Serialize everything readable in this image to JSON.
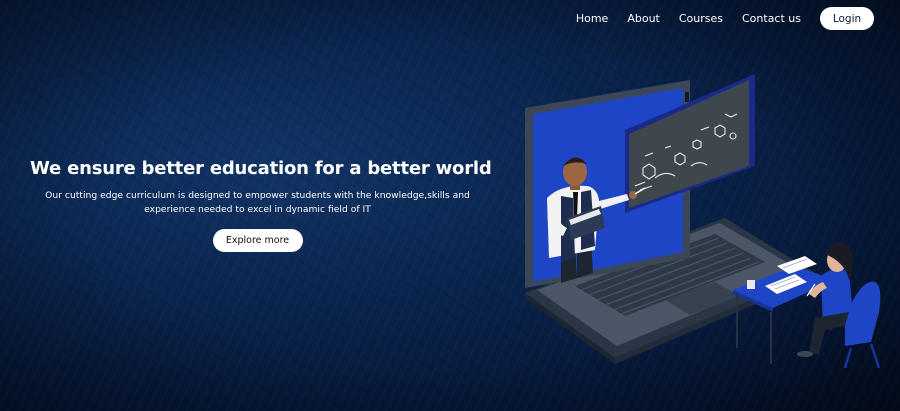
{
  "nav": {
    "links": [
      "Home",
      "About",
      "Courses",
      "Contact us"
    ],
    "login_label": "Login"
  },
  "hero": {
    "title": "We ensure better education for a better world",
    "description": "Our cutting edge curriculum is designed to empower students with the knowledge,skills and experience needed to excel in dynamic field of IT",
    "cta_label": "Explore more"
  },
  "colors": {
    "background": "#0b2650",
    "accent": "#1f45c7",
    "button_bg": "#ffffff"
  },
  "illustration": {
    "name": "online-education-laptop-illustration"
  }
}
